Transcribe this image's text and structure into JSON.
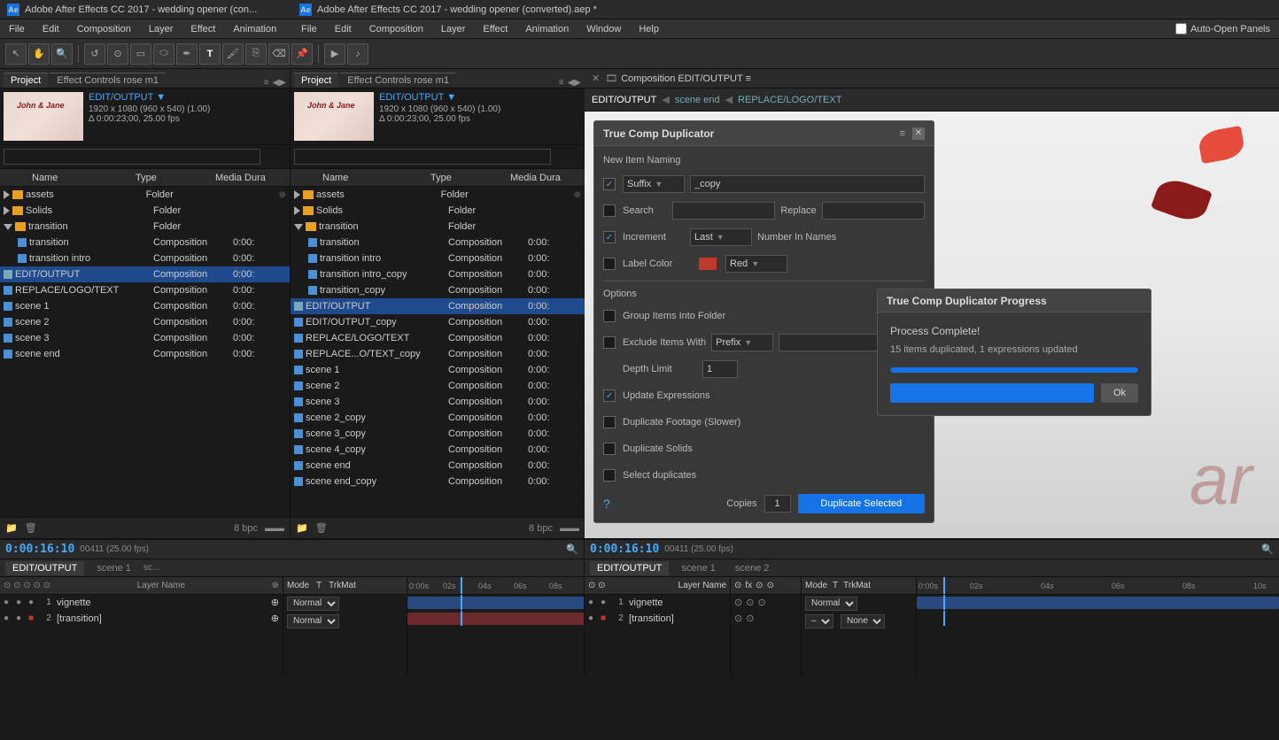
{
  "window": {
    "title1": "Adobe After Effects CC 2017 - wedding opener (con...",
    "title2": "Adobe After Effects CC 2017 - wedding opener (converted).aep *",
    "icon_label": "Ae"
  },
  "menu": {
    "items": [
      "File",
      "Edit",
      "Composition",
      "Layer",
      "Effect",
      "Animation",
      "File",
      "Edit",
      "Composition",
      "Layer",
      "Effect",
      "Animation",
      "Help",
      "Window",
      "Help"
    ]
  },
  "toolbar": {
    "auto_open_panels": "Auto-Open Panels"
  },
  "left_panel": {
    "tabs": [
      {
        "label": "Project",
        "active": true
      },
      {
        "label": "Effect Controls rose m1",
        "active": false
      }
    ],
    "edit_output": "EDIT/OUTPUT ▼",
    "comp_info": "1920 x 1080  (960 x 540)  (1.00)",
    "comp_delta": "Δ 0:00:23;00, 25.00 fps",
    "search_placeholder": "",
    "columns": {
      "name": "Name",
      "type": "Type",
      "media_dur": "Media Dura"
    },
    "items": [
      {
        "indent": 0,
        "expand": true,
        "name": "assets",
        "type_icon": "folder",
        "type": "Folder",
        "media": "",
        "selected": false
      },
      {
        "indent": 0,
        "expand": false,
        "name": "Solids",
        "type_icon": "folder",
        "type": "Folder",
        "media": "",
        "selected": false
      },
      {
        "indent": 0,
        "expand": true,
        "name": "transition",
        "type_icon": "folder",
        "type": "Folder",
        "media": "",
        "selected": false
      },
      {
        "indent": 1,
        "expand": false,
        "name": "transition",
        "type_icon": "comp",
        "type": "Composition",
        "media": "0:00:",
        "selected": false
      },
      {
        "indent": 1,
        "expand": false,
        "name": "transition intro",
        "type_icon": "comp",
        "type": "Composition",
        "media": "0:00:",
        "selected": false
      },
      {
        "indent": 0,
        "expand": false,
        "name": "EDIT/OUTPUT",
        "type_icon": "comp",
        "type": "Composition",
        "media": "0:00:",
        "selected": true
      },
      {
        "indent": 0,
        "expand": false,
        "name": "REPLACE/LOGO/TEXT",
        "type_icon": "comp",
        "type": "Composition",
        "media": "0:00:",
        "selected": false
      },
      {
        "indent": 0,
        "expand": false,
        "name": "scene 1",
        "type_icon": "comp",
        "type": "Composition",
        "media": "0:00:",
        "selected": false
      },
      {
        "indent": 0,
        "expand": false,
        "name": "scene 2",
        "type_icon": "comp",
        "type": "Composition",
        "media": "0:00:",
        "selected": false
      },
      {
        "indent": 0,
        "expand": false,
        "name": "scene 3",
        "type_icon": "comp",
        "type": "Composition",
        "media": "0:00:",
        "selected": false
      },
      {
        "indent": 0,
        "expand": false,
        "name": "scene end",
        "type_icon": "comp",
        "type": "Composition",
        "media": "0:00:",
        "selected": false
      }
    ]
  },
  "right_panel": {
    "tabs": [
      {
        "label": "Project",
        "active": true
      },
      {
        "label": "Effect Controls rose m1",
        "active": false
      }
    ],
    "edit_output": "EDIT/OUTPUT ▼",
    "comp_info": "1920 x 1080  (960 x 540)  (1.00)",
    "comp_delta": "Δ 0:00:23;00, 25.00 fps",
    "items": [
      {
        "indent": 0,
        "expand": true,
        "name": "assets",
        "type_icon": "folder",
        "type": "Folder",
        "media": ""
      },
      {
        "indent": 0,
        "expand": false,
        "name": "Solids",
        "type_icon": "folder",
        "type": "Folder",
        "media": ""
      },
      {
        "indent": 0,
        "expand": true,
        "name": "transition",
        "type_icon": "folder",
        "type": "Folder",
        "media": ""
      },
      {
        "indent": 1,
        "name": "transition",
        "type_icon": "comp",
        "type": "Composition",
        "media": "0:00:"
      },
      {
        "indent": 1,
        "name": "transition intro",
        "type_icon": "comp",
        "type": "Composition",
        "media": "0:00:"
      },
      {
        "indent": 1,
        "name": "transition intro_copy",
        "type_icon": "comp",
        "type": "Composition",
        "media": "0:00:"
      },
      {
        "indent": 1,
        "name": "transition_copy",
        "type_icon": "comp",
        "type": "Composition",
        "media": "0:00:"
      },
      {
        "indent": 0,
        "name": "EDIT/OUTPUT",
        "type_icon": "comp",
        "type": "Composition",
        "media": "0:00:",
        "selected": true
      },
      {
        "indent": 0,
        "name": "EDIT/OUTPUT_copy",
        "type_icon": "comp",
        "type": "Composition",
        "media": "0:00:"
      },
      {
        "indent": 0,
        "name": "REPLACE/LOGO/TEXT",
        "type_icon": "comp",
        "type": "Composition",
        "media": "0:00:"
      },
      {
        "indent": 0,
        "name": "REPLACE...O/TEXT_copy",
        "type_icon": "comp",
        "type": "Composition",
        "media": "0:00:"
      },
      {
        "indent": 0,
        "name": "scene 1",
        "type_icon": "comp",
        "type": "Composition",
        "media": "0:00:"
      },
      {
        "indent": 0,
        "name": "scene 2",
        "type_icon": "comp",
        "type": "Composition",
        "media": "0:00:"
      },
      {
        "indent": 0,
        "name": "scene 3",
        "type_icon": "comp",
        "type": "Composition",
        "media": "0:00:"
      },
      {
        "indent": 0,
        "name": "scene 2_copy",
        "type_icon": "comp",
        "type": "Composition",
        "media": "0:00:"
      },
      {
        "indent": 0,
        "name": "scene 3_copy",
        "type_icon": "comp",
        "type": "Composition",
        "media": "0:00:"
      },
      {
        "indent": 0,
        "name": "scene 4_copy",
        "type_icon": "comp",
        "type": "Composition",
        "media": "0:00:"
      },
      {
        "indent": 0,
        "name": "scene end",
        "type_icon": "comp",
        "type": "Composition",
        "media": "0:00:"
      },
      {
        "indent": 0,
        "name": "scene end_copy",
        "type_icon": "comp",
        "type": "Composition",
        "media": "0:00:"
      }
    ]
  },
  "comp_viewer": {
    "tabs": [
      "EDIT/OUTPUT",
      "scene end",
      "REPLACE/LOGO/TEXT"
    ],
    "active_tab": "EDIT/OUTPUT",
    "comp_header": "Composition EDIT/OUTPUT ≡"
  },
  "tcd_panel": {
    "title": "True Comp Duplicator",
    "menu_icon": "≡",
    "close_icon": "✕",
    "new_item_naming": "New Item Naming",
    "suffix_label": "Suffix",
    "suffix_dropdown_value": "Suffix",
    "suffix_value": "_copy",
    "search_label": "Search",
    "replace_label": "Replace",
    "increment_label": "Increment",
    "increment_value": "Last",
    "number_in_names": "Number In Names",
    "label_color_label": "Label Color",
    "label_color_value": "Red",
    "options_label": "Options",
    "group_items_folder": "Group Items Into Folder",
    "exclude_items_with": "Exclude Items With",
    "prefix_value": "Prefix",
    "depth_limit_label": "Depth Limit",
    "depth_limit_value": "1",
    "update_expressions": "Update Expressions",
    "duplicate_footage": "Duplicate Footage (Slower)",
    "duplicate_solids": "Duplicate Solids",
    "select_duplicates": "Select duplicates",
    "help_icon": "?",
    "copies_label": "Copies",
    "copies_value": "1",
    "duplicate_selected_btn": "Duplicate Selected",
    "checked_items": [
      "suffix_checked",
      "increment_checked",
      "update_expressions_checked"
    ]
  },
  "progress_dialog": {
    "title": "True Comp Duplicator Progress",
    "complete_msg": "Process Complete!",
    "details": "15 items duplicated, 1 expressions updated",
    "ok_btn": "Ok"
  },
  "timeline_left": {
    "label": "EDIT/OUTPUT",
    "scene1": "scene 1",
    "timecode": "0:00:16:10",
    "fps_info": "00411 (25.00 fps)",
    "layers": [
      {
        "num": "1",
        "name": "vignette",
        "has_eye": true
      },
      {
        "num": "2",
        "name": "[transition]",
        "has_eye": true
      }
    ],
    "mode_value": "Normal",
    "columns": [
      "Mode",
      "T",
      "TrkMat"
    ]
  },
  "timeline_right": {
    "label": "EDIT/OUTPUT",
    "scene1": "scene 1",
    "scene2": "scene 2",
    "timecode": "0:00:16:10",
    "fps_info": "00411 (25.00 fps)",
    "layers": [
      {
        "num": "1",
        "name": "vignette",
        "has_eye": true
      },
      {
        "num": "2",
        "name": "[transition]",
        "has_eye": true
      }
    ],
    "mode_value": "Normal",
    "none_value": "None"
  },
  "timeline_ruler": {
    "markers": [
      "0:00s",
      "02s",
      "04s",
      "06s",
      "08s",
      "10s"
    ]
  },
  "bpc_value": "8 bpc"
}
